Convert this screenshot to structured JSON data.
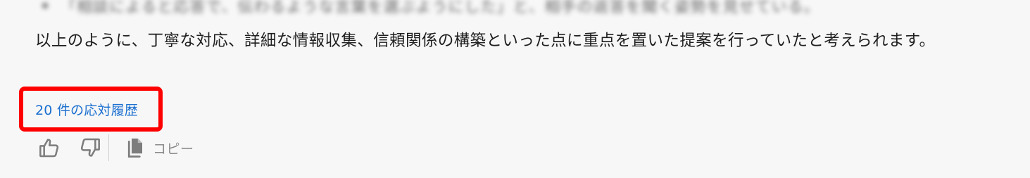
{
  "previous_item": {
    "blurred_text": "「相談によると応答で、伝わるような言葉を選ぶようにした」と、相手の返答を聞く姿勢を見せている。"
  },
  "answer": {
    "text": "以上のように、丁寧な対応、詳細な情報収集、信頼関係の構築といった点に重点を置いた提案を行っていたと考えられます。"
  },
  "history": {
    "label": "20 件の応対履歴"
  },
  "actions": {
    "thumbs_up_icon": "thumbs-up-icon",
    "thumbs_down_icon": "thumbs-down-icon",
    "copy_icon": "copy-icon",
    "copy_label": "コピー"
  },
  "colors": {
    "background": "#f7f7f7",
    "text": "#1f1f1f",
    "link": "#1a6fd0",
    "highlight_border": "#ff0000",
    "icon": "#8a8a8a"
  }
}
